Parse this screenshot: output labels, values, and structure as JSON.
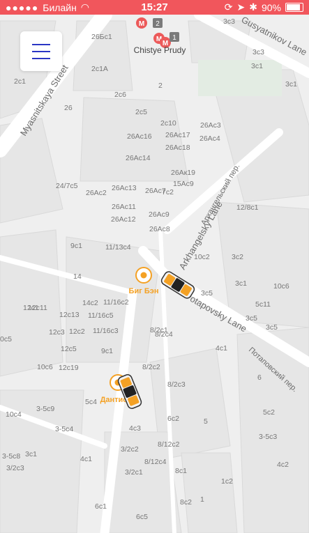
{
  "status_bar": {
    "carrier": "Билайн",
    "time": "15:27",
    "battery": "90%"
  },
  "metro": {
    "line_badge_1": "2",
    "line_badge_2": "1",
    "station_name": "Chistye Prudy"
  },
  "streets": {
    "myasnitskaya": "Myasnitskaya Street",
    "gusyatnikov": "Gusyatnikov Lane",
    "arkhangelsky_en": "Arkhangelsky Lane",
    "arkhangelsky_ru": "Архангельский пер.",
    "potapovsky_en": "Potapovsky Lane",
    "potapovsky_ru": "Потаповский пер."
  },
  "points": {
    "big_ben": "Биг Бэн",
    "dantis": "Дантис"
  },
  "building_labels": [
    "3c3",
    "26Бс1",
    "3с3",
    "3с1",
    "2с1А",
    "2",
    "3c1",
    "2с1",
    "2с6",
    "26",
    "2с5",
    "2с10",
    "26Ас3",
    "26Ас16",
    "26Ас17",
    "26Ас4",
    "26Ас18",
    "26Ас14",
    "26Ак19",
    "15Ас9",
    "24/7с5",
    "26Ас2",
    "26Ас13",
    "26Ас7",
    "7с2",
    "26Ас11",
    "26Ас9",
    "12/8с1",
    "26Ас12",
    "26Ас8",
    "9с1",
    "11/13с4",
    "10с2",
    "3с2",
    "14",
    "3с5",
    "3с1",
    "10с6",
    "12с1",
    "14с2",
    "11/16с2",
    "12с11",
    "12с13",
    "11/16с5",
    "5с11",
    "3с5",
    "12с3",
    "12с2",
    "11/16с3",
    "8/2с1",
    "3с5",
    "0с5",
    "12с5",
    "9с1",
    "8/2с4",
    "4с1",
    "10с6",
    "12с19",
    "8/2с2",
    "6",
    "5с4",
    "8/2с3",
    "10с4",
    "3-5с9",
    "6с2",
    "5",
    "5с2",
    "3-5с4",
    "4с3",
    "3-5с8",
    "3с1",
    "4с1",
    "3/2с2",
    "8/12с2",
    "3-5с3",
    "3/2с3",
    "8/12с4",
    "4с2",
    "3/2с1",
    "8с1",
    "1с2",
    "6с1",
    "8с2",
    "1",
    "6с5"
  ]
}
